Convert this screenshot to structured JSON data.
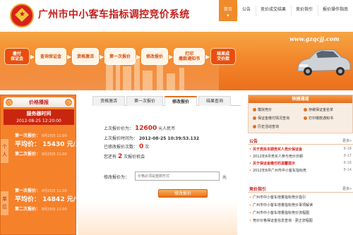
{
  "header": {
    "title": "广州市中小客车指标调控竞价系统",
    "nav": [
      {
        "label": "首页",
        "active": true
      },
      {
        "label": "公告",
        "active": false
      },
      {
        "label": "竞价成交结果",
        "active": false
      },
      {
        "label": "竞价指引",
        "active": false
      },
      {
        "label": "报价操作指南",
        "active": false
      }
    ]
  },
  "banner": {
    "url": "www.gzqcjj.com",
    "steps": [
      "缴付\n保证金",
      "查询保证金",
      "资格激活",
      "第一次报价",
      "修改报价",
      "打印\n缴款通知书",
      "结果成\n交价款"
    ]
  },
  "left": {
    "tab_label": "价格播报",
    "server_time_label": "服务器时间",
    "server_time_value": "2012-08-25  12:20:00",
    "groups": [
      {
        "badge": "个人",
        "first_bid_label": "第一次报价：",
        "first_bid_date": "8月25日 11:00",
        "avg_label": "平均价：",
        "avg_value": "15430 元/人",
        "second_bid_label": "第二次报价：",
        "second_bid_date": "8月25日 11:00"
      },
      {
        "badge": "单位",
        "first_bid_label": "第一次报价：",
        "first_bid_date": "8月25日 11:00",
        "avg_label": "平均价：",
        "avg_value": "14842 元/个",
        "second_bid_label": "第二次报价：",
        "second_bid_date": "8月25日 11:00"
      }
    ]
  },
  "center": {
    "tabs": [
      {
        "label": "资格激活",
        "active": false
      },
      {
        "label": "第一次报价",
        "active": false
      },
      {
        "label": "修改报价",
        "active": true
      },
      {
        "label": "结果查询",
        "active": false
      }
    ],
    "last_price_label": "上次报价价为：",
    "last_price_value": "12600",
    "last_price_unit": "元人民币",
    "last_time_label": "上次报价时间为：",
    "last_time_value": "2012-08-25 10:39:53.132",
    "modified_label": "已修改报价次数：",
    "modified_value": "0",
    "modified_unit": "次",
    "remaining_prefix": "您还有",
    "remaining_value": "2",
    "remaining_suffix": "次报价机会",
    "input_label": "修改报价为：",
    "input_placeholder": "价格必须是整数形式",
    "input_unit": "元",
    "submit_label": "修改报价"
  },
  "right": {
    "quick_title": "快捷通道",
    "quick_links": [
      "模拟竞价",
      "存缓保证金名单",
      "保证金缴付情况查询",
      "打印缴款通知书",
      "历史活动查询"
    ],
    "notice_title": "公告",
    "notice_more": "更多»",
    "notices": [
      {
        "text": "关于竞拆本期竞买人竞价保证金",
        "date": "8-18",
        "highlight": true
      },
      {
        "text": "2012年8月竞买人参与竞价日期",
        "date": "8-17",
        "highlight": false
      },
      {
        "text": "关于保证金缴付的温馨提示",
        "date": "8-16",
        "highlight": true
      },
      {
        "text": "2012年8月广州市中小客车指标竞",
        "date": "8-14",
        "highlight": false
      }
    ],
    "guide_title": "竞价指引",
    "guide_more": "更多»",
    "guides": [
      {
        "text": "广州市中小客车增量指标竞价指引"
      },
      {
        "text": "广州市中小客车增量指标竞价事项解读"
      },
      {
        "text": "广州市中小客车增量指标竞价流程图"
      },
      {
        "text": "竞价价格保证金信息查询 · 更正流程图"
      }
    ]
  },
  "colors": {
    "brand_red": "#c51d1a",
    "brand_orange": "#f08a2a"
  }
}
